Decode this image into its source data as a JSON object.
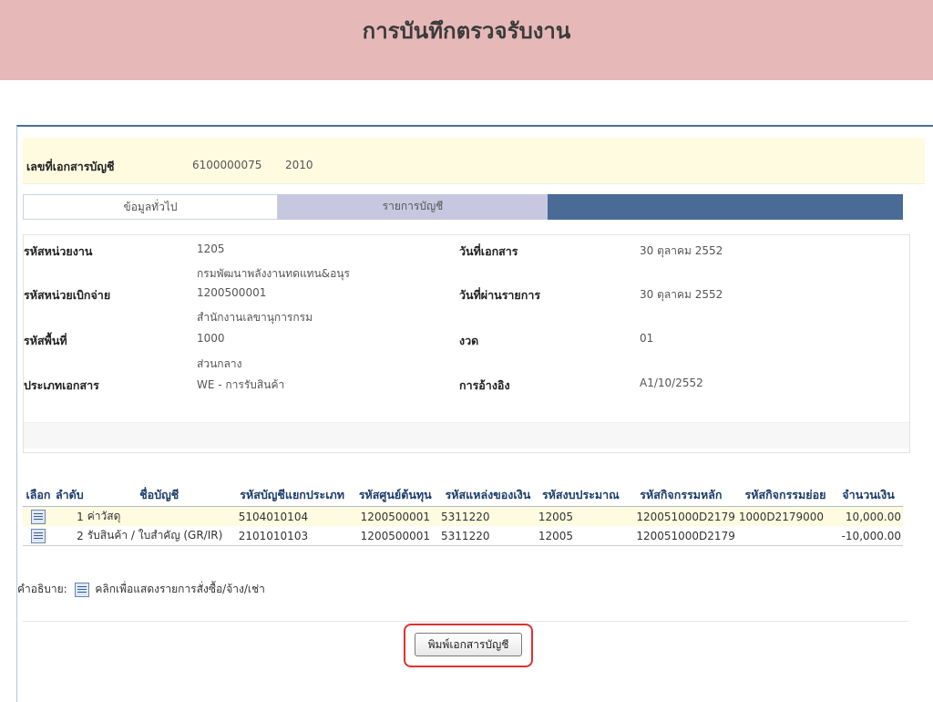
{
  "header": {
    "title": "การบันทึกตรวจรับงาน"
  },
  "document": {
    "label": "เลขที่เอกสารบัญชี",
    "number": "6100000075",
    "year": "2010"
  },
  "tabs": [
    {
      "label": "ข้อมูลทั่วไป"
    },
    {
      "label": "รายการบัญชี"
    }
  ],
  "info": {
    "unit_code_label": "รหัสหน่วยงาน",
    "unit_code": "1205",
    "unit_name": "กรมพัฒนาพลังงานทดแทน&อนุร",
    "disb_code_label": "รหัสหน่วยเบิกจ่าย",
    "disb_code": "1200500001",
    "disb_name": "สำนักงานเลขานุการกรม",
    "area_code_label": "รหัสพื้นที่",
    "area_code": "1000",
    "area_name": "ส่วนกลาง",
    "doc_type_label": "ประเภทเอกสาร",
    "doc_type": "WE - การรับสินค้า",
    "doc_date_label": "วันที่เอกสาร",
    "doc_date": "30 ตุลาคม 2552",
    "post_date_label": "วันที่ผ่านรายการ",
    "post_date": "30 ตุลาคม 2552",
    "period_label": "งวด",
    "period": "01",
    "ref_label": "การอ้างอิง",
    "ref": "A1/10/2552"
  },
  "table": {
    "headers": [
      "เลือก",
      "ลำดับ",
      "ชื่อบัญชี",
      "รหัสบัญชีแยกประเภท",
      "รหัสศูนย์ต้นทุน",
      "รหัสแหล่งของเงิน",
      "รหัสงบประมาณ",
      "รหัสกิจกรรมหลัก",
      "รหัสกิจกรรมย่อย",
      "จำนวนเงิน"
    ],
    "rows": [
      {
        "seq": "1",
        "account_name": "ค่าวัสดุ",
        "gl_code": "5104010104",
        "cost_center": "1200500001",
        "fund_source": "5311220",
        "budget_code": "12005",
        "main_activity": "120051000D2179",
        "sub_activity": "1000D2179000",
        "amount": "10,000.00"
      },
      {
        "seq": "2",
        "account_name": "รับสินค้า / ใบสำคัญ (GR/IR)",
        "gl_code": "2101010103",
        "cost_center": "1200500001",
        "fund_source": "5311220",
        "budget_code": "12005",
        "main_activity": "120051000D2179",
        "sub_activity": "",
        "amount": "-10,000.00"
      }
    ]
  },
  "legend": {
    "prefix": "คำอธิบาย:",
    "text": "คลิกเพื่อแสดงรายการสั่งซื้อ/จ้าง/เช่า"
  },
  "actions": {
    "print_label": "พิมพ์เอกสารบัญชี"
  },
  "colors": {
    "banner": "#e6b9b8",
    "tab_bar": "#4a6b96",
    "highlight": "#e03131",
    "row_highlight": "#fffbe1"
  }
}
